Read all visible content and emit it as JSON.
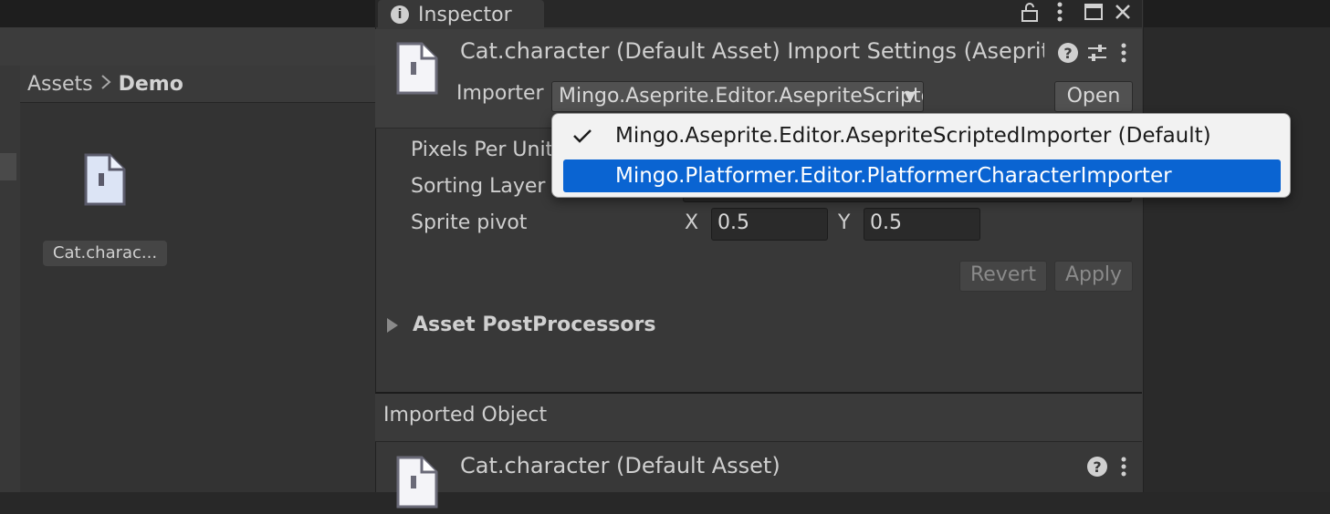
{
  "inspector": {
    "tab_label": "Inspector",
    "header_title": "Cat.character (Default Asset) Import Settings (Aseprite",
    "importer_label": "Importer",
    "importer_value": "Mingo.Aseprite.Editor.AsepriteScriptedImporter",
    "open_label": "Open"
  },
  "breadcrumb": {
    "root": "Assets",
    "separator": ">",
    "current": "Demo"
  },
  "asset": {
    "label": "Cat.charac..."
  },
  "properties": {
    "pixels_per_unit": "Pixels Per Unit",
    "sorting_layer": "Sorting Layer",
    "sprite_pivot": "Sprite pivot",
    "pivot_x_label": "X",
    "pivot_x_value": "0.5",
    "pivot_y_label": "Y",
    "pivot_y_value": "0.5"
  },
  "buttons": {
    "revert": "Revert",
    "apply": "Apply"
  },
  "foldout": {
    "postprocessors": "Asset PostProcessors"
  },
  "imported": {
    "section_title": "Imported Object",
    "object_title": "Cat.character (Default Asset)"
  },
  "dropdown": {
    "items": [
      {
        "label": "Mingo.Aseprite.Editor.AsepriteScriptedImporter (Default)",
        "checked": true
      },
      {
        "label": "Mingo.Platformer.Editor.PlatformerCharacterImporter",
        "highlighted": true
      }
    ]
  },
  "icons": {
    "info": "info-icon",
    "lock": "lock-icon",
    "kebab": "kebab-menu-icon",
    "maximize": "maximize-icon",
    "close": "close-icon",
    "help": "help-icon",
    "presets": "presets-icon",
    "file": "file-icon",
    "check": "check-icon",
    "chevron": "chevron-right-icon",
    "dropdown_arrow": "dropdown-arrow-icon"
  },
  "colors": {
    "highlight": "#0a64d2",
    "panel": "#383838",
    "popup": "#f2f2f2"
  }
}
